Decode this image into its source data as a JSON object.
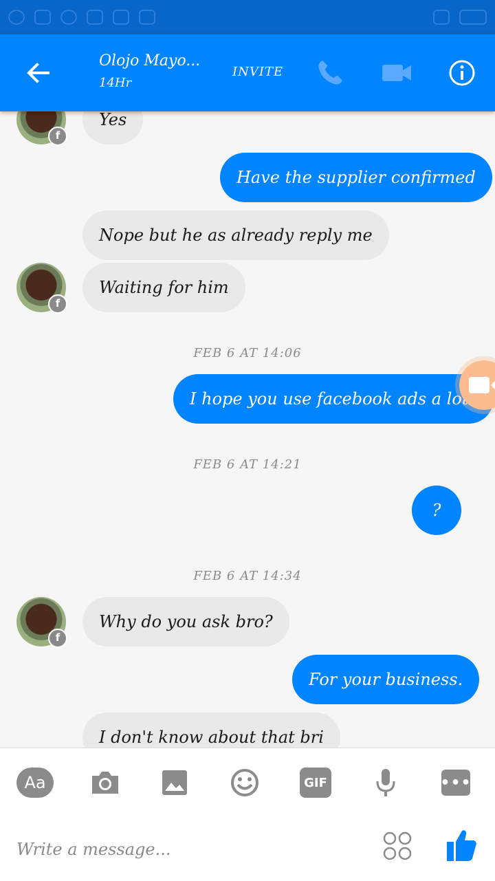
{
  "header": {
    "contact_name": "Olojo Mayo...",
    "contact_status": "14Hr",
    "invite_label": "INVITE"
  },
  "messages": {
    "m1": "Yes",
    "m2": "Have the supplier confirmed",
    "m3": "Nope but he as already reply me",
    "m4": "Waiting for him",
    "ts1": "FEB 6 AT 14:06",
    "m5": "I hope you use facebook ads a lot?",
    "ts2": "FEB 6 AT 14:21",
    "m6": "?",
    "ts3": "FEB 6 AT 14:34",
    "m7": "Why do you ask bro?",
    "m8": "For your business.",
    "m9": "I don't know about that bri"
  },
  "composer": {
    "aa_label": "Aa",
    "gif_label": "GIF",
    "more_label": "•••",
    "placeholder": "Write a message..."
  },
  "colors": {
    "brand_blue": "#0084ff",
    "incoming_bubble": "#e9e9e9"
  },
  "icons": [
    "back-arrow-icon",
    "phone-icon",
    "video-camera-icon",
    "info-icon",
    "camera-icon",
    "image-icon",
    "emoji-icon",
    "microphone-icon",
    "sticker-icon",
    "thumbs-up-icon"
  ]
}
